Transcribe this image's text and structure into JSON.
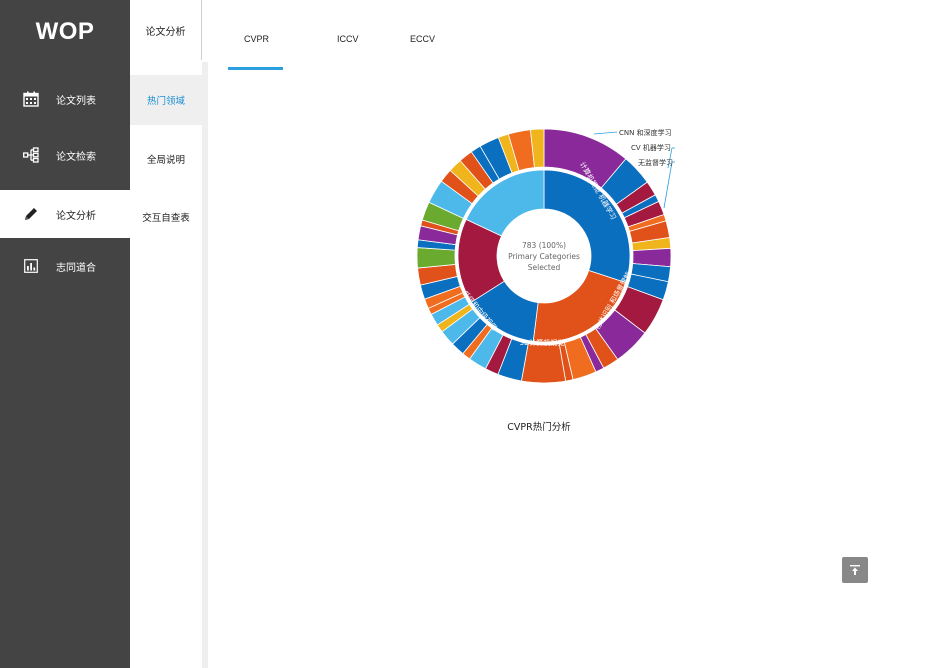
{
  "app": {
    "logo": "WOP"
  },
  "sidebar": {
    "items": [
      {
        "label": "论文列表",
        "icon": "calendar-icon"
      },
      {
        "label": "论文检索",
        "icon": "hierarchy-icon"
      },
      {
        "label": "论文分析",
        "icon": "pencil-icon",
        "active": true
      },
      {
        "label": "志同道合",
        "icon": "bar-chart-icon"
      }
    ]
  },
  "submenu": {
    "title": "论文分析",
    "items": [
      {
        "label": "热门领域",
        "active": true
      },
      {
        "label": "全局说明"
      },
      {
        "label": "交互自查表"
      }
    ]
  },
  "tabs": [
    {
      "label": "CVPR",
      "active": true
    },
    {
      "label": "ICCV"
    },
    {
      "label": "ECCV"
    }
  ],
  "chart": {
    "center_lines": [
      "783 (100%)",
      "Primary Categories",
      "Selected"
    ],
    "caption": "CVPR热门分析",
    "legend_labels": [
      "CNN 和深度学习",
      "CV 机器学习",
      "无监督学习"
    ],
    "inner_segment_labels": [
      "计算机视觉\n机器学习",
      "物体识别\n和场景理解",
      "3D计算机视觉",
      "低级和中级视觉"
    ]
  },
  "chart_data": {
    "type": "pie",
    "inner_ring": [
      {
        "name": "计算机视觉 机器学习",
        "value": 30,
        "color": "#0a6fbf"
      },
      {
        "name": "物体识别 和场景理解",
        "value": 22,
        "color": "#e0521a"
      },
      {
        "name": "3D计算机视觉",
        "value": 14,
        "color": "#0a6fbf"
      },
      {
        "name": "低级和中级视觉",
        "value": 16,
        "color": "#a3193f"
      },
      {
        "name": "",
        "value": 18,
        "color": "#4db8ea"
      }
    ],
    "outer_palette": [
      "#8a2a9a",
      "#0a6fbf",
      "#4db8ea",
      "#e0521a",
      "#a3193f",
      "#6aaa2e",
      "#f0b41c",
      "#f06c1f"
    ]
  },
  "colors": {
    "sidebar_bg": "#444444",
    "accent_blue": "#2b9fe0",
    "submenu_active_text": "#1c8fd6"
  }
}
